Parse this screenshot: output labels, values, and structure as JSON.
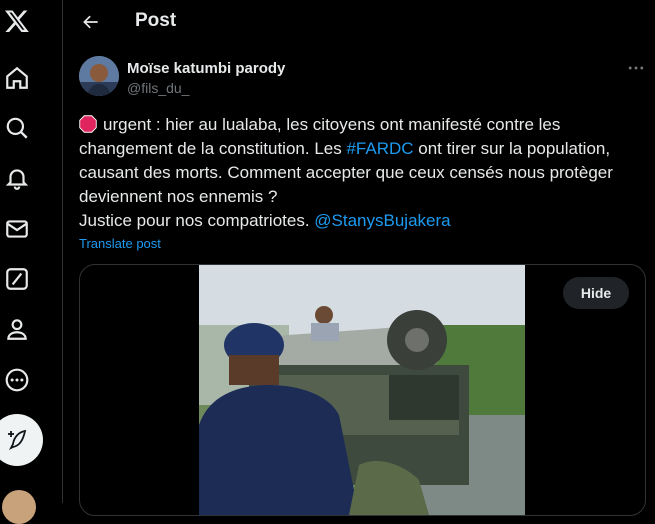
{
  "header": {
    "title": "Post"
  },
  "author": {
    "name": "Moïse katumbi parody",
    "handle": "@fils_du_"
  },
  "tweet": {
    "line1_text": "urgent : hier au lualaba, les citoyens ont manifesté contre les changement de la constitution. Les ",
    "hashtag": "#FARDC",
    "line1_rest": " ont tirer sur la population, causant des morts. Comment accepter que ceux censés nous protèger deviennent nos ennemis ?",
    "line2_text": "Justice pour nos compatriotes. ",
    "mention": "@StanysBujakera",
    "translate_label": "Translate post"
  },
  "media": {
    "hide_label": "Hide"
  },
  "icons": {
    "logo": "x-logo-icon",
    "home": "home-icon",
    "explore": "search-icon",
    "notifications": "bell-icon",
    "messages": "envelope-icon",
    "grok": "grok-icon",
    "profile": "person-icon",
    "more": "more-circle-icon",
    "compose": "feather-plus-icon",
    "stop": "stop-sign-icon",
    "back": "arrow-left-icon",
    "overflow": "ellipsis-icon"
  },
  "colors": {
    "accent": "#1d9bf0",
    "background": "#000000",
    "text": "#e7e9ea",
    "muted": "#71767b",
    "border": "#2f3336"
  }
}
